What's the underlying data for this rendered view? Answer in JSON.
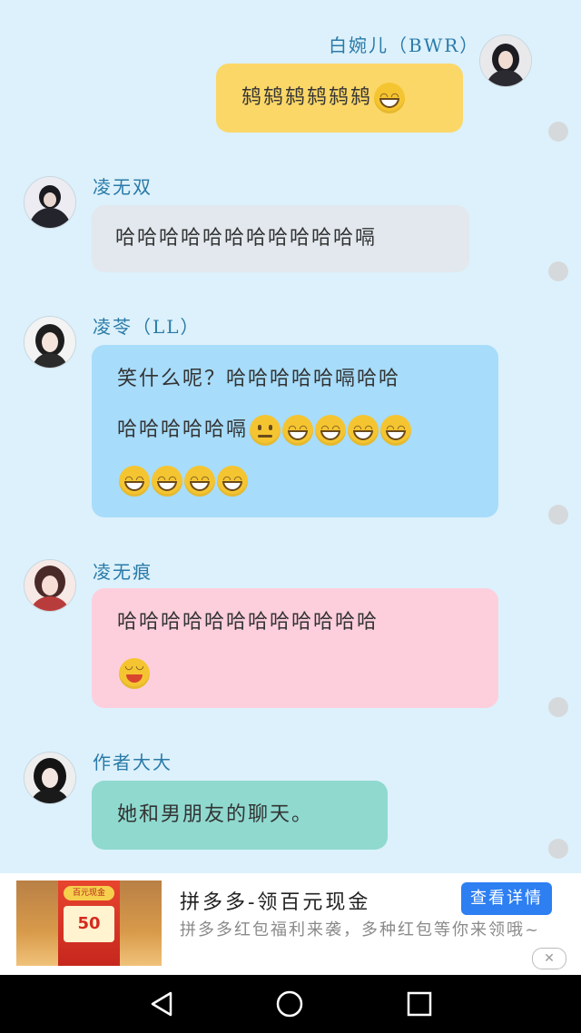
{
  "messages": [
    {
      "id": "m1",
      "sender": "白婉儿（BWR）",
      "align": "right",
      "text_lines": [
        "鸫鸫鸫鸫鸫鸫"
      ],
      "emojis": [
        [
          "laugh"
        ]
      ],
      "bubble_color": "#fbd768"
    },
    {
      "id": "m2",
      "sender": "凌无双",
      "align": "left",
      "text_lines": [
        "哈哈哈哈哈哈哈哈哈哈哈嗝"
      ],
      "emojis": [
        []
      ],
      "bubble_color": "#e2e8ee"
    },
    {
      "id": "m3",
      "sender": "凌苓（LL）",
      "align": "left",
      "text_lines": [
        "笑什么呢？哈哈哈哈哈嗝哈哈",
        "哈哈哈哈哈嗝",
        ""
      ],
      "emojis": [
        [],
        [
          "neutral",
          "laugh",
          "laugh",
          "laugh",
          "laugh"
        ],
        [
          "laugh",
          "laugh",
          "laugh",
          "laugh"
        ]
      ],
      "bubble_color": "#a7dcfa"
    },
    {
      "id": "m4",
      "sender": "凌无痕",
      "align": "left",
      "text_lines": [
        "哈哈哈哈哈哈哈哈哈哈哈哈",
        ""
      ],
      "emojis": [
        [],
        [
          "smile"
        ]
      ],
      "bubble_color": "#fdcfdd"
    },
    {
      "id": "m5",
      "sender": "作者大大",
      "align": "left",
      "text_lines": [
        "她和男朋友的聊天。"
      ],
      "emojis": [
        []
      ],
      "bubble_color": "#8fd9cf"
    }
  ],
  "ad": {
    "title": "拼多多-领百元现金",
    "description": "拼多多红包福利来袭，多种红包等你来领哦~",
    "button_label": "查看详情",
    "close_label": "✕",
    "thumb_badge": "百元现金",
    "thumb_amount": "50"
  },
  "navbar": {
    "icons": [
      "back-icon",
      "home-icon",
      "recent-apps-icon"
    ]
  }
}
